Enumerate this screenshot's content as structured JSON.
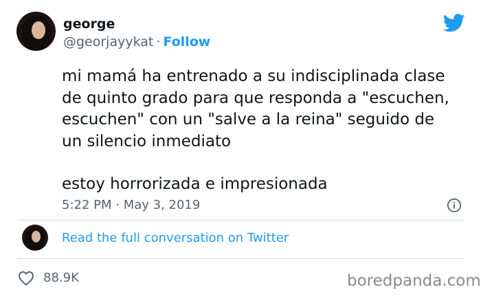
{
  "tweet": {
    "author_name": "george",
    "handle": "@georjayykat",
    "separator": "·",
    "follow_label": "Follow",
    "text_paragraph_1": "mi mamá ha entrenado a su indisciplinada clase\nde quinto grado para que responda a \"escuchen,\nescuchen\" con un \"salve a la reina\" seguido de\nun silencio inmediato",
    "text_paragraph_2": "estoy horrorizada e impresionada",
    "timestamp": "5:22 PM · May 3, 2019",
    "read_more_label": "Read the full conversation on Twitter",
    "like_count": "88.9K"
  },
  "icons": {
    "brand": "twitter-bird-icon",
    "info": "info-icon",
    "like": "heart-icon"
  },
  "colors": {
    "accent": "#1d9bf0",
    "muted": "#536471",
    "text": "#0f1419",
    "divider": "#cfd9de"
  },
  "watermark": "boredpanda.com"
}
